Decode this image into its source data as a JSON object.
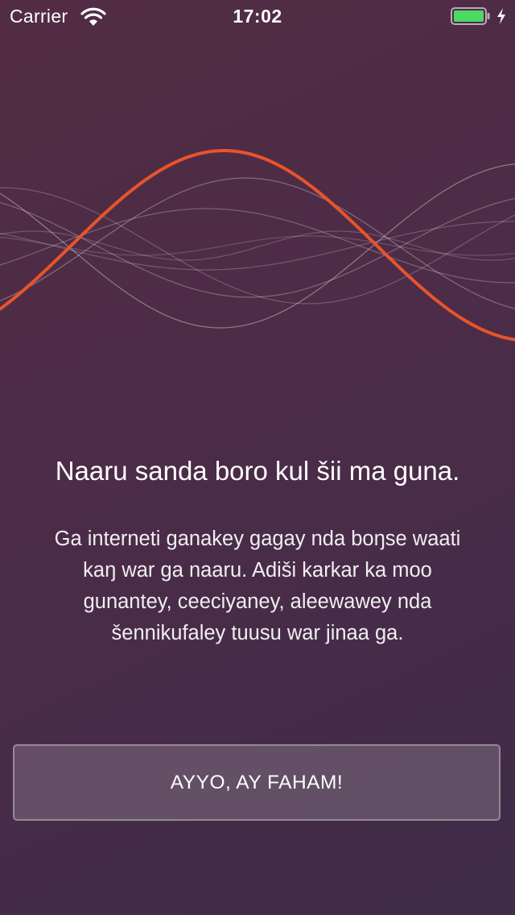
{
  "status_bar": {
    "carrier": "Carrier",
    "time": "17:02",
    "wifi_icon": "wifi-icon",
    "battery_icon": "battery-icon",
    "charging_icon": "charging-bolt-icon",
    "battery_color": "#4cd964"
  },
  "hero": {
    "graphic": "waveform-illustration",
    "accent_color": "#e8542a"
  },
  "message": {
    "title": "Naaru sanda boro kul šii ma guna.",
    "body_lines": [
      "Ga interneti ganakey gagay nda boŋse waati",
      "kaŋ war ga naaru. Adiši karkar ka moo",
      "gunantey, ceeciyaney, aleewawey nda",
      "šennikufaley tuusu war jinaa ga."
    ]
  },
  "actions": {
    "confirm_label": "AYYO, AY FAHAM!"
  }
}
